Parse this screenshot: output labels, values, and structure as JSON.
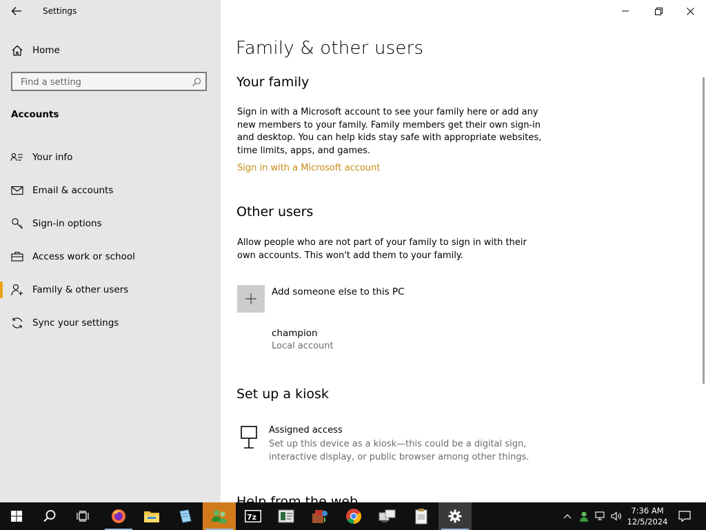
{
  "window": {
    "title": "Settings",
    "controls": {
      "minimize": "minimize-icon",
      "restore": "restore-icon",
      "close": "close-icon"
    }
  },
  "sidebar": {
    "home_label": "Home",
    "search_placeholder": "Find a setting",
    "section_label": "Accounts",
    "items": [
      {
        "label": "Your info",
        "icon": "contact-card-icon"
      },
      {
        "label": "Email & accounts",
        "icon": "mail-icon"
      },
      {
        "label": "Sign-in options",
        "icon": "key-icon"
      },
      {
        "label": "Access work or school",
        "icon": "briefcase-icon"
      },
      {
        "label": "Family & other users",
        "icon": "person-add-icon",
        "active": true
      },
      {
        "label": "Sync your settings",
        "icon": "sync-icon"
      }
    ],
    "accent_color": "#e8a317"
  },
  "main": {
    "page_title": "Family & other users",
    "your_family": {
      "heading": "Your family",
      "description": "Sign in with a Microsoft account to see your family here or add any new members to your family. Family members get their own sign-in and desktop. You can help kids stay safe with appropriate websites, time limits, apps, and games.",
      "link": "Sign in with a Microsoft account",
      "link_color": "#c98a12"
    },
    "other_users": {
      "heading": "Other users",
      "description": "Allow people who are not part of your family to sign in with their own accounts. This won't add them to your family.",
      "add_label": "Add someone else to this PC",
      "users": [
        {
          "name": "champion",
          "type": "Local account"
        }
      ]
    },
    "kiosk": {
      "heading": "Set up a kiosk",
      "title": "Assigned access",
      "description": "Set up this device as a kiosk—this could be a digital sign, interactive display, or public browser among other things."
    },
    "next_heading_partial": "Help from the web"
  },
  "taskbar": {
    "apps": [
      {
        "name": "start-icon"
      },
      {
        "name": "search-icon"
      },
      {
        "name": "task-view-icon"
      },
      {
        "name": "firefox-icon"
      },
      {
        "name": "file-explorer-icon"
      },
      {
        "name": "notepad-icon"
      },
      {
        "name": "users-app-icon"
      },
      {
        "name": "7zip-icon"
      },
      {
        "name": "media-player-icon"
      },
      {
        "name": "archive-tool-icon"
      },
      {
        "name": "chrome-icon"
      },
      {
        "name": "network-tool-icon"
      },
      {
        "name": "clipboard-icon"
      },
      {
        "name": "settings-gear-icon"
      }
    ],
    "tray": [
      "chevron-up-icon",
      "people-icon",
      "network-icon",
      "volume-icon"
    ],
    "clock": {
      "time": "7:36 AM",
      "date": "12/5/2024"
    },
    "notification_icon": "action-center-icon"
  }
}
